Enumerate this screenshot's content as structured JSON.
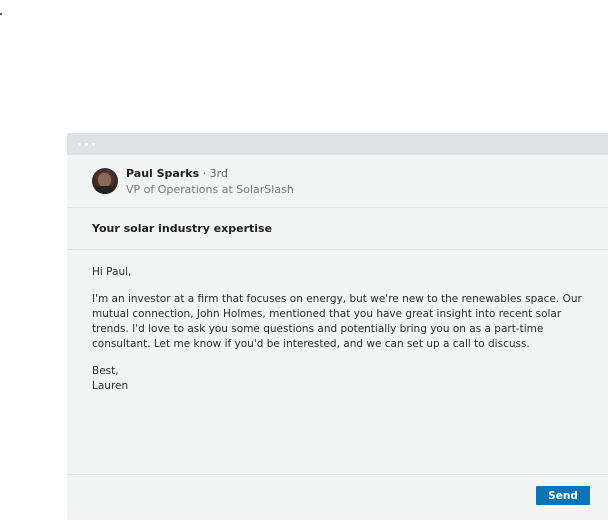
{
  "message": {
    "recipient": {
      "name": "Paul Sparks",
      "degree": "· 3rd",
      "headline": "VP of Operations at SolarSlash"
    },
    "subject": "Your solar industry expertise",
    "greeting": "Hi Paul,",
    "paragraph": "I'm an investor at a firm that focuses on energy, but we're new to the renewables space. Our mutual connection, John Holmes, mentioned that you have great insight into recent solar trends. I'd love to ask you some questions and potentially bring you on as a part-time consultant. Let me know if you'd be interested, and we can set up a call to discuss.",
    "signoff": "Best,",
    "signature": "Lauren"
  },
  "actions": {
    "send_label": "Send"
  },
  "colors": {
    "accent": "#0b73b8",
    "card_bg": "#f3f4f4",
    "titlebar_bg": "#dfe2e5"
  }
}
